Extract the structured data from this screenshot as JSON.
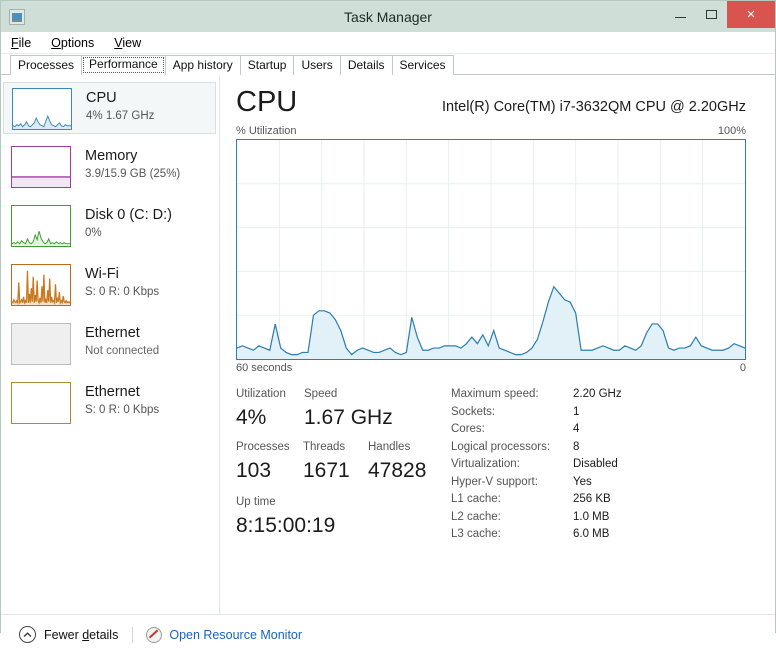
{
  "window": {
    "title": "Task Manager",
    "app_icon": "task-manager-icon",
    "minimize": "–",
    "maximize": "□",
    "close": "×"
  },
  "menu": [
    {
      "label": "File",
      "accel": "F"
    },
    {
      "label": "Options",
      "accel": "O"
    },
    {
      "label": "View",
      "accel": "V"
    }
  ],
  "tabs": [
    {
      "label": "Processes",
      "active": false
    },
    {
      "label": "Performance",
      "active": true
    },
    {
      "label": "App history",
      "active": false
    },
    {
      "label": "Startup",
      "active": false
    },
    {
      "label": "Users",
      "active": false
    },
    {
      "label": "Details",
      "active": false
    },
    {
      "label": "Services",
      "active": false
    }
  ],
  "sidebar": {
    "items": [
      {
        "name": "CPU",
        "sub": "4%  1.67 GHz",
        "color": "#3b8ab8",
        "selected": true
      },
      {
        "name": "Memory",
        "sub": "3.9/15.9 GB (25%)",
        "color": "#9b3fa0",
        "selected": false
      },
      {
        "name": "Disk 0 (C: D:)",
        "sub": "0%",
        "color": "#3f9c35",
        "selected": false
      },
      {
        "name": "Wi-Fi",
        "sub": "S: 0 R: 0 Kbps",
        "color": "#c06a1e",
        "selected": false
      },
      {
        "name": "Ethernet",
        "sub": "Not connected",
        "color": "#b0b0b0",
        "selected": false
      },
      {
        "name": "Ethernet",
        "sub": "S: 0 R: 0 Kbps",
        "color": "#b08a2e",
        "selected": false
      }
    ]
  },
  "main": {
    "title": "CPU",
    "cpu_model": "Intel(R) Core(TM) i7-3632QM CPU @ 2.20GHz",
    "graph_axis_label": "% Utilization",
    "graph_axis_max": "100%",
    "time_left": "60 seconds",
    "time_right": "0",
    "stats": [
      {
        "label": "Utilization",
        "value": "4%"
      },
      {
        "label": "Speed",
        "value": "1.67 GHz"
      },
      {
        "label": "Processes",
        "value": "103"
      },
      {
        "label": "Threads",
        "value": "1671"
      },
      {
        "label": "Handles",
        "value": "47828"
      },
      {
        "label": "Up time",
        "value": "8:15:00:19"
      }
    ],
    "specs": [
      {
        "key": "Maximum speed:",
        "value": "2.20 GHz"
      },
      {
        "key": "Sockets:",
        "value": "1"
      },
      {
        "key": "Cores:",
        "value": "4"
      },
      {
        "key": "Logical processors:",
        "value": "8"
      },
      {
        "key": "Virtualization:",
        "value": "Disabled"
      },
      {
        "key": "Hyper-V support:",
        "value": "Yes"
      },
      {
        "key": "L1 cache:",
        "value": "256 KB"
      },
      {
        "key": "L2 cache:",
        "value": "1.0 MB"
      },
      {
        "key": "L3 cache:",
        "value": "6.0 MB"
      }
    ]
  },
  "footer": {
    "fewer_details": "Fewer details",
    "fewer_details_accel": "d",
    "open_resource_monitor": "Open Resource Monitor"
  },
  "colors": {
    "titlebar": "#cfdfd8",
    "close_button": "#d9534f",
    "graph_line": "#2c7eae",
    "graph_fill": "#ddeef7",
    "link": "#1664c0"
  },
  "chart_data": {
    "type": "area",
    "title": "% Utilization",
    "xlabel": "60 seconds",
    "ylabel": "% Utilization",
    "xlim": [
      60,
      0
    ],
    "ylim": [
      0,
      100
    ],
    "grid": true,
    "legend": null,
    "series": [
      {
        "name": "CPU Utilization",
        "values": [
          5,
          6,
          5,
          4,
          6,
          5,
          4,
          16,
          5,
          3,
          2,
          2,
          3,
          3,
          20,
          22,
          22,
          21,
          18,
          13,
          5,
          2,
          4,
          5,
          4,
          3,
          3,
          4,
          5,
          3,
          2,
          3,
          19,
          10,
          4,
          4,
          5,
          5,
          6,
          6,
          6,
          5,
          7,
          10,
          7,
          11,
          6,
          13,
          5,
          4,
          3,
          2,
          2,
          3,
          5,
          9,
          17,
          26,
          33,
          30,
          27,
          26,
          21,
          4,
          4,
          4,
          5,
          6,
          5,
          4,
          4,
          6,
          5,
          4,
          6,
          12,
          16,
          16,
          13,
          5,
          4,
          5,
          5,
          6,
          10,
          6,
          5,
          4,
          4,
          4,
          5,
          7,
          6,
          5
        ]
      }
    ],
    "thumbnails": {
      "cpu": [
        4,
        3,
        5,
        4,
        3,
        6,
        4,
        3,
        9,
        5,
        3,
        4,
        6,
        12,
        8,
        5,
        4,
        3,
        10,
        15,
        9,
        5,
        4,
        3,
        5,
        7,
        4,
        3,
        5,
        4
      ],
      "memory_level": 25,
      "disk": [
        3,
        5,
        4,
        3,
        6,
        4,
        3,
        5,
        8,
        4,
        3,
        5,
        12,
        9,
        20,
        14,
        8,
        5,
        4,
        3,
        6,
        9,
        5,
        4,
        3,
        5,
        4,
        3,
        4,
        3
      ],
      "wifi": [
        4,
        30,
        6,
        4,
        8,
        5,
        50,
        12,
        6,
        28,
        14,
        40,
        9,
        18,
        55,
        10,
        6,
        24,
        42,
        8,
        14,
        6,
        30,
        10,
        5,
        8,
        6,
        12,
        5,
        4
      ]
    }
  }
}
